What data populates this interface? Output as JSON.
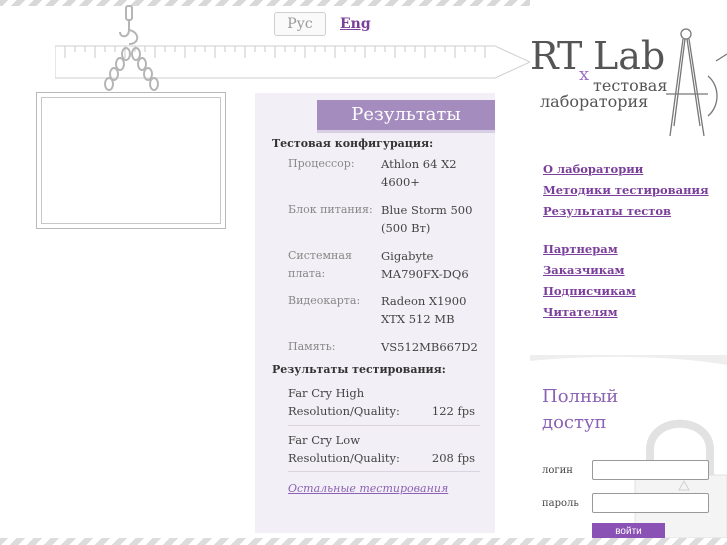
{
  "language": {
    "current": "Рус",
    "other": "Eng"
  },
  "results_panel": {
    "title": "Результаты",
    "config_heading": "Тестовая конфигурация:",
    "config": [
      {
        "label": "Процессор:",
        "value": "Athlon 64 X2 4600+"
      },
      {
        "label": "Блок питания:",
        "value": "Blue Storm 500 (500 Вт)"
      },
      {
        "label": "Системная плата:",
        "value": "Gigabyte MA790FX-DQ6"
      },
      {
        "label": "Видеокарта:",
        "value": "Radeon X1900 XTX 512 MB"
      },
      {
        "label": "Память:",
        "value": "VS512MB667D2"
      }
    ],
    "results_heading": "Результаты тестирования:",
    "results": [
      {
        "label": "Far Cry High Resolution/Quality:",
        "value": "122 fps"
      },
      {
        "label": "Far Cry Low Resolution/Quality:",
        "value": "208 fps"
      }
    ],
    "other_tests_link": "Остальные тестирования"
  },
  "logo": {
    "rt": "RT",
    "x": "x",
    "lab": "Lab",
    "subtitle_line1": "тестовая",
    "subtitle_line2": "лаборатория"
  },
  "nav_primary": [
    "О лаборатории",
    "Методики тестирования",
    "Результаты тестов"
  ],
  "nav_secondary": [
    "Партнерам",
    "Заказчикам",
    "Подписчикам",
    "Читателям"
  ],
  "login": {
    "title": "Полный доступ",
    "login_label": "логин",
    "password_label": "пароль",
    "login_value": "",
    "password_value": "",
    "submit_label": "войти"
  },
  "colors": {
    "accent": "#8a52b5",
    "link": "#7a3f9a",
    "panel_bg": "#f2eff6",
    "title_bg": "#a58cbf"
  }
}
